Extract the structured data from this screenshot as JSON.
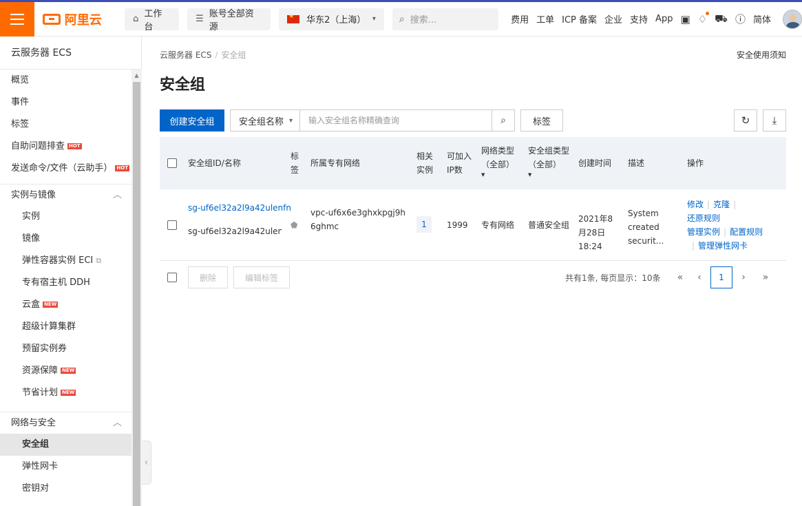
{
  "topbar": {
    "brand": "阿里云",
    "workbench": "工作台",
    "resources": "账号全部资源",
    "region": "华东2（上海）",
    "search_placeholder": "搜索...",
    "links": [
      "费用",
      "工单",
      "ICP 备案",
      "企业",
      "支持",
      "App"
    ],
    "language": "简体"
  },
  "sidebar": {
    "title": "云服务器 ECS",
    "top_items": [
      {
        "label": "概览"
      },
      {
        "label": "事件"
      },
      {
        "label": "标签"
      },
      {
        "label": "自助问题排查",
        "badge": "HOT"
      },
      {
        "label": "发送命令/文件（云助手）",
        "badge": "HOT"
      }
    ],
    "group_instances": "实例与镜像",
    "instances_items": [
      {
        "label": "实例"
      },
      {
        "label": "镜像"
      },
      {
        "label": "弹性容器实例 ECI"
      },
      {
        "label": "专有宿主机 DDH"
      },
      {
        "label": "云盒",
        "badge": "NEW"
      },
      {
        "label": "超级计算集群"
      },
      {
        "label": "预留实例券"
      },
      {
        "label": "资源保障",
        "badge": "NEW"
      },
      {
        "label": "节省计划",
        "badge": "NEW"
      }
    ],
    "group_network": "网络与安全",
    "network_items": [
      {
        "label": "安全组"
      },
      {
        "label": "弹性网卡"
      },
      {
        "label": "密钥对"
      }
    ]
  },
  "main": {
    "breadcrumb_root": "云服务器 ECS",
    "breadcrumb_current": "安全组",
    "safety_link": "安全使用须知",
    "page_title": "安全组",
    "create_button": "创建安全组",
    "filter_select": "安全组名称",
    "search_placeholder": "输入安全组名称精确查询",
    "tag_button": "标签"
  },
  "table": {
    "headers": {
      "id_name": "安全组ID/名称",
      "tag": "标签",
      "vpc": "所属专有网络",
      "related": "相关实例",
      "ip_count": "可加入IP数",
      "network_type": "网络类型（全部）",
      "sg_type": "安全组类型（全部）",
      "created": "创建时间",
      "desc": "描述",
      "ops": "操作"
    },
    "rows": [
      {
        "id": "sg-uf6el32a2l9a42ulenfn",
        "name": "sg-uf6el32a2l9a42ulenf...",
        "vpc": "vpc-uf6x6e3ghxkpgj9h6ghmc",
        "related_count": "1",
        "ip_count": "1999",
        "network_type": "专有网络",
        "sg_type": "普通安全组",
        "created": "2021年8月28日 18:24",
        "desc": "System created securit...",
        "ops": {
          "modify": "修改",
          "clone": "克隆",
          "restore": "还原规则",
          "manage_instances": "管理实例",
          "config_rules": "配置规则",
          "manage_eni": "管理弹性网卡"
        }
      }
    ]
  },
  "footer": {
    "delete_button": "删除",
    "edit_tags_button": "编辑标签",
    "pager_summary": "共有1条, 每页显示：10条",
    "current_page": "1"
  }
}
